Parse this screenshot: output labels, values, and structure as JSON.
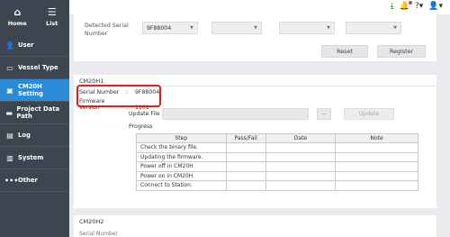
{
  "sidebar": {
    "top": [
      {
        "label": "Home",
        "icon": "home-icon"
      },
      {
        "label": "List",
        "icon": "list-icon"
      }
    ],
    "items": [
      {
        "label": "User",
        "icon": "user-gear-icon"
      },
      {
        "label": "Vessel Type",
        "icon": "vessel-icon"
      },
      {
        "label": "CM20H Setting",
        "icon": "device-settings-icon",
        "active": true
      },
      {
        "label": "Project Data Path",
        "icon": "folder-icon"
      },
      {
        "label": "Log",
        "icon": "log-icon"
      },
      {
        "label": "System",
        "icon": "system-icon"
      },
      {
        "label": "Other",
        "icon": "more-icon"
      }
    ]
  },
  "topbar": {
    "icons": [
      "download-icon",
      "notification-bell-icon",
      "help-icon",
      "user-account-icon"
    ]
  },
  "detected": {
    "label": "Detected Serial Number",
    "selects": [
      "9F88004",
      "",
      "",
      ""
    ],
    "reset_label": "Reset",
    "register_label": "Register"
  },
  "cm20h1": {
    "title": "CM20H1",
    "serial_label": "Serial Number",
    "serial_value": "9F88004",
    "firmware_label": "Firmware Version",
    "firmware_value": "1101",
    "update_file_label": "Update File",
    "browse_label": "...",
    "update_label": "Update",
    "progress_label": "Progress",
    "progress_table": {
      "headers": [
        "Step",
        "Pass/Fail",
        "Date",
        "Note"
      ],
      "rows": [
        [
          "Check the binary file.",
          "",
          "",
          ""
        ],
        [
          "Updating the firmware.",
          "",
          "",
          ""
        ],
        [
          "Power off in CM20H",
          "",
          "",
          ""
        ],
        [
          "Power on in CM20H",
          "",
          "",
          ""
        ],
        [
          "Connect to Station.",
          "",
          "",
          ""
        ]
      ]
    }
  },
  "cm20h2": {
    "title": "CM20H2",
    "serial_label": "Serial Number"
  },
  "colors": {
    "sidebar_bg": "#3d4550",
    "active_item": "#2c8bd6",
    "highlight_box": "#e51b1b"
  }
}
